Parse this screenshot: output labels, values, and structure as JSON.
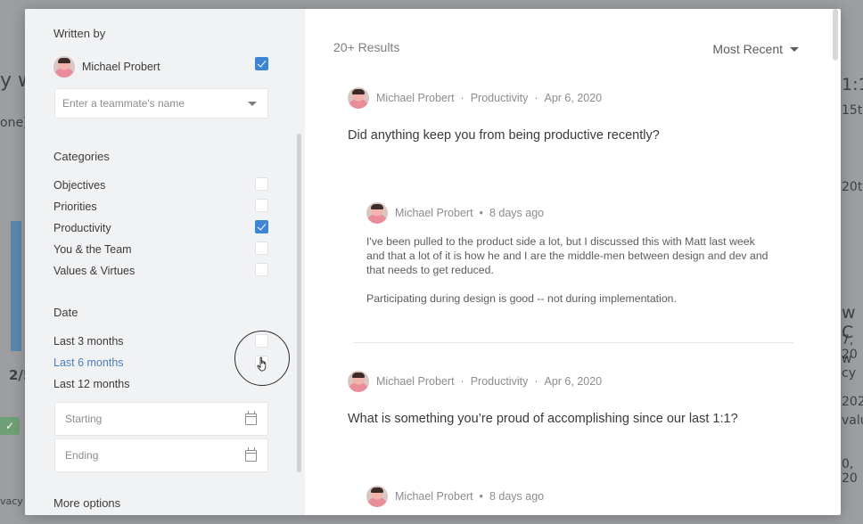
{
  "background": {
    "fragments": [
      "y w",
      "one)",
      "2/5",
      "vacy",
      "1:1s",
      "15th",
      "20th",
      "w C",
      "7, 20",
      "w cy",
      "202",
      "valu",
      "0, 20"
    ],
    "badge_icon": "check-icon"
  },
  "sidebar": {
    "written_by_label": "Written by",
    "author": {
      "name": "Michael Probert",
      "checked": true
    },
    "teammate_placeholder": "Enter a teammate's name",
    "categories_label": "Categories",
    "categories": [
      {
        "label": "Objectives",
        "checked": false
      },
      {
        "label": "Priorities",
        "checked": false
      },
      {
        "label": "Productivity",
        "checked": true
      },
      {
        "label": "You & the Team",
        "checked": false
      },
      {
        "label": "Values & Virtues",
        "checked": false
      }
    ],
    "date_label": "Date",
    "dates": [
      {
        "label": "Last 3 months",
        "checked": false
      },
      {
        "label": "Last 6 months",
        "checked": false
      },
      {
        "label": "Last 12 months",
        "checked": false
      }
    ],
    "starting_placeholder": "Starting",
    "ending_placeholder": "Ending",
    "more_options": "More options"
  },
  "main": {
    "results_count": "20+ Results",
    "sort_label": "Most Recent",
    "posts": [
      {
        "author": "Michael Probert",
        "category": "Productivity",
        "date": "Apr 6, 2020",
        "question": "Did anything keep you from being productive recently?",
        "reply": {
          "author": "Michael Probert",
          "time": "8 days ago",
          "paragraph1_line1": "I've been pulled to the product side a lot, but I discussed this with Matt last week",
          "paragraph1_line2": "and that a lot of it is how he and I are the middle-men between design and dev and",
          "paragraph1_line3": "that needs to get reduced.",
          "paragraph2": "Participating during design is good -- not during implementation."
        }
      },
      {
        "author": "Michael Probert",
        "category": "Productivity",
        "date": "Apr 6, 2020",
        "question": "What is something you’re proud of accomplishing since our last 1:1?",
        "reply": {
          "author": "Michael Probert",
          "time": "8 days ago"
        }
      }
    ]
  },
  "colors": {
    "accent": "#3d86d6",
    "link": "#4a7fb8"
  }
}
